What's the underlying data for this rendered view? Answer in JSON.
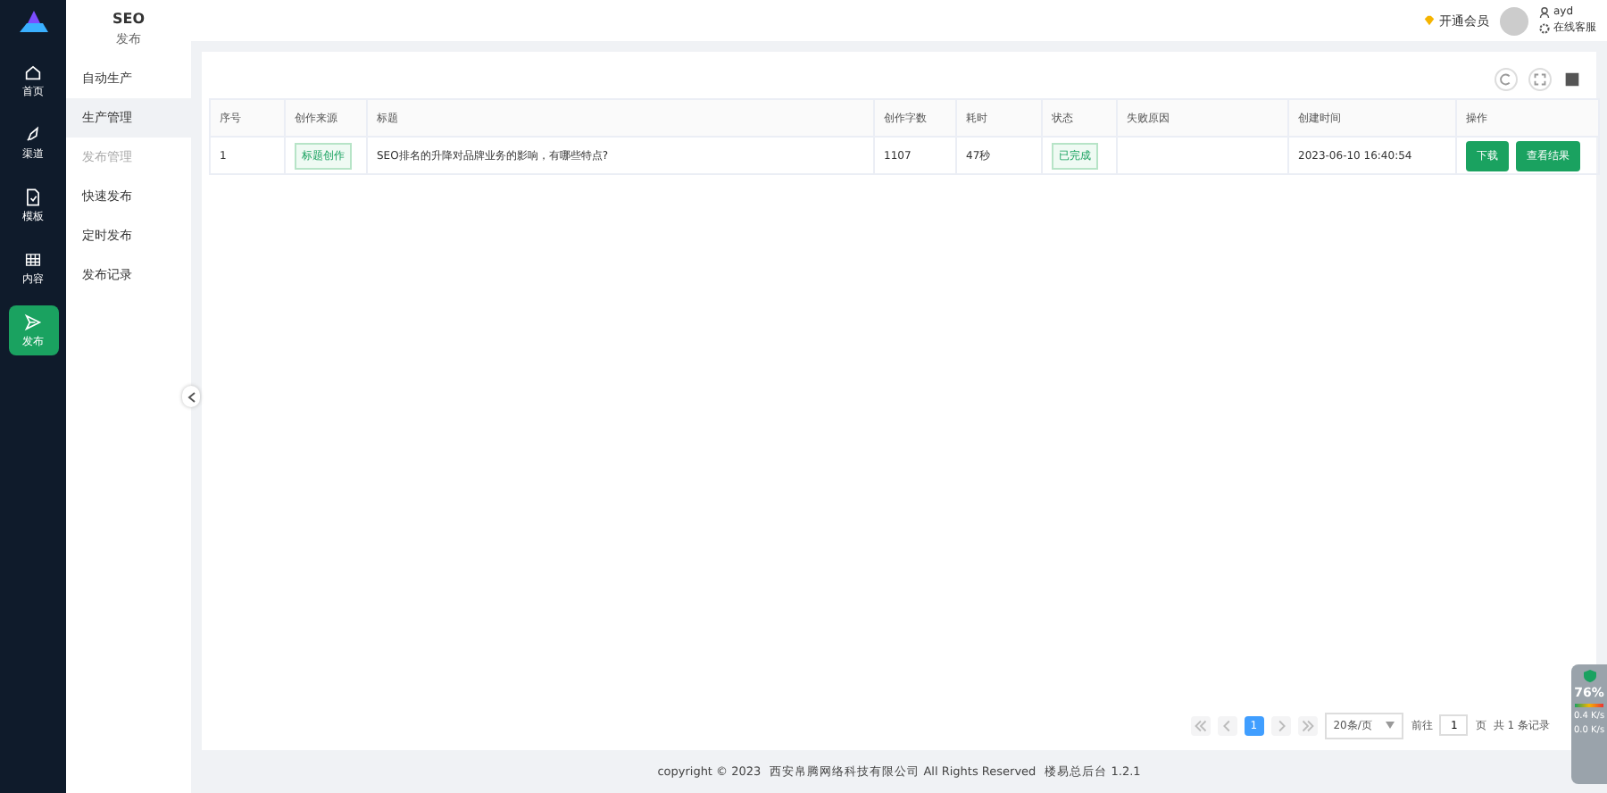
{
  "rail": {
    "items": [
      {
        "label": "首页",
        "selected": false
      },
      {
        "label": "渠道",
        "selected": false
      },
      {
        "label": "模板",
        "selected": false
      },
      {
        "label": "内容",
        "selected": false
      },
      {
        "label": "发布",
        "selected": true
      }
    ]
  },
  "submenu": {
    "title": "SEO",
    "section": "发布",
    "items": [
      {
        "label": "自动生产",
        "selected": false,
        "disabled": false
      },
      {
        "label": "生产管理",
        "selected": true,
        "disabled": false
      },
      {
        "label": "发布管理",
        "selected": false,
        "disabled": true
      },
      {
        "label": "快速发布",
        "selected": false,
        "disabled": false
      },
      {
        "label": "定时发布",
        "selected": false,
        "disabled": false
      },
      {
        "label": "发布记录",
        "selected": false,
        "disabled": false
      }
    ]
  },
  "header": {
    "vip": "开通会员",
    "user": "ayd",
    "service": "在线客服"
  },
  "table": {
    "columns": [
      "序号",
      "创作来源",
      "标题",
      "创作字数",
      "耗时",
      "状态",
      "失败原因",
      "创建时间",
      "操作"
    ],
    "rows": [
      {
        "index": "1",
        "source": "标题创作",
        "title": "SEO排名的升降对品牌业务的影响，有哪些特点?",
        "words": "1107",
        "duration": "47秒",
        "status": "已完成",
        "created": "2023-06-10 16:40:54",
        "actions": [
          "下载",
          "查看结果"
        ]
      }
    ]
  },
  "pagination": {
    "pages": [
      {
        "label": "1",
        "selected": true
      }
    ],
    "page_size": "20条/页",
    "goto": "前往",
    "goto_value": "1",
    "page_unit": "页",
    "total": "共 1 条记录"
  },
  "footer": {
    "copyright": "copyright © 2023",
    "company": "西安帛腾网络科技有限公司 All Rights Reserved",
    "version": "楼易总后台 1.2.1"
  },
  "monitor": {
    "percent": "76",
    "unit": "%",
    "up": "0.4",
    "up_unit": "K/s",
    "down": "0.0",
    "down_unit": "K/s"
  }
}
